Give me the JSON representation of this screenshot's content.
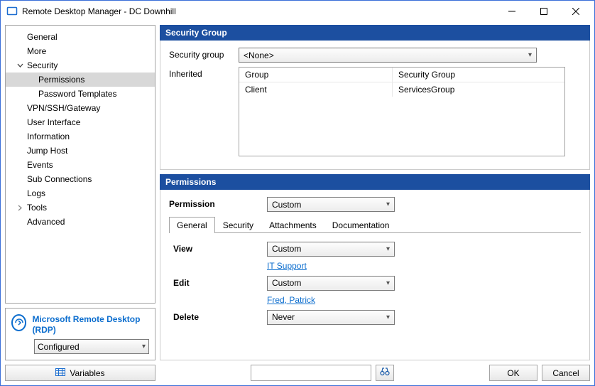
{
  "window": {
    "title": "Remote Desktop Manager - DC Downhill"
  },
  "sidebar": {
    "items": [
      {
        "label": "General"
      },
      {
        "label": "More"
      },
      {
        "label": "Security",
        "expanded": true
      },
      {
        "label": "Permissions",
        "child": true,
        "selected": true
      },
      {
        "label": "Password Templates",
        "child": true
      },
      {
        "label": "VPN/SSH/Gateway"
      },
      {
        "label": "User Interface"
      },
      {
        "label": "Information"
      },
      {
        "label": "Jump Host"
      },
      {
        "label": "Events"
      },
      {
        "label": "Sub Connections"
      },
      {
        "label": "Logs"
      },
      {
        "label": "Tools",
        "collapsed": true
      },
      {
        "label": "Advanced"
      }
    ],
    "info": {
      "title": "Microsoft Remote Desktop (RDP)",
      "status": "Configured"
    }
  },
  "security_group": {
    "header": "Security Group",
    "label": "Security group",
    "value": "<None>",
    "inherited_label": "Inherited",
    "columns": [
      "Group",
      "Security Group"
    ],
    "rows": [
      [
        "Client",
        "ServicesGroup"
      ]
    ]
  },
  "permissions": {
    "header": "Permissions",
    "label": "Permission",
    "value": "Custom",
    "tabs": [
      "General",
      "Security",
      "Attachments",
      "Documentation"
    ],
    "active_tab": 0,
    "rows": [
      {
        "label": "View",
        "value": "Custom",
        "link": "IT Support"
      },
      {
        "label": "Edit",
        "value": "Custom",
        "link": "Fred, Patrick"
      },
      {
        "label": "Delete",
        "value": "Never"
      }
    ]
  },
  "footer": {
    "variables": "Variables",
    "ok": "OK",
    "cancel": "Cancel",
    "search_placeholder": ""
  }
}
